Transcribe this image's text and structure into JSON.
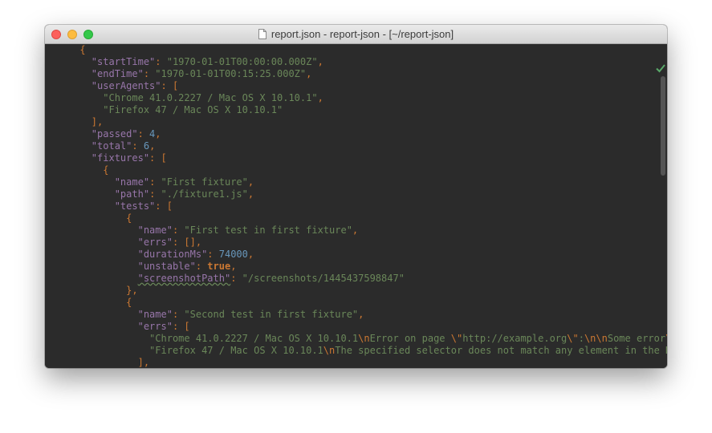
{
  "window": {
    "title": "report.json - report-json - [~/report-json]"
  },
  "editor": {
    "lines": [
      [
        {
          "c": "p",
          "t": "      {"
        }
      ],
      [
        {
          "c": "p",
          "t": "        "
        },
        {
          "c": "k",
          "t": "\"startTime\""
        },
        {
          "c": "p",
          "t": ": "
        },
        {
          "c": "s",
          "t": "\"1970-01-01T00:00:00.000Z\""
        },
        {
          "c": "p",
          "t": ","
        }
      ],
      [
        {
          "c": "p",
          "t": "        "
        },
        {
          "c": "k",
          "t": "\"endTime\""
        },
        {
          "c": "p",
          "t": ": "
        },
        {
          "c": "s",
          "t": "\"1970-01-01T00:15:25.000Z\""
        },
        {
          "c": "p",
          "t": ","
        }
      ],
      [
        {
          "c": "p",
          "t": "        "
        },
        {
          "c": "k",
          "t": "\"userAgents\""
        },
        {
          "c": "p",
          "t": ": ["
        }
      ],
      [
        {
          "c": "p",
          "t": "          "
        },
        {
          "c": "s",
          "t": "\"Chrome 41.0.2227 / Mac OS X 10.10.1\""
        },
        {
          "c": "p",
          "t": ","
        }
      ],
      [
        {
          "c": "p",
          "t": "          "
        },
        {
          "c": "s",
          "t": "\"Firefox 47 / Mac OS X 10.10.1\""
        }
      ],
      [
        {
          "c": "p",
          "t": "        ],"
        }
      ],
      [
        {
          "c": "p",
          "t": "        "
        },
        {
          "c": "k",
          "t": "\"passed\""
        },
        {
          "c": "p",
          "t": ": "
        },
        {
          "c": "n",
          "t": "4"
        },
        {
          "c": "p",
          "t": ","
        }
      ],
      [
        {
          "c": "p",
          "t": "        "
        },
        {
          "c": "k",
          "t": "\"total\""
        },
        {
          "c": "p",
          "t": ": "
        },
        {
          "c": "n",
          "t": "6"
        },
        {
          "c": "p",
          "t": ","
        }
      ],
      [
        {
          "c": "p",
          "t": "        "
        },
        {
          "c": "k",
          "t": "\"fixtures\""
        },
        {
          "c": "p",
          "t": ": ["
        }
      ],
      [
        {
          "c": "p",
          "t": "          {"
        }
      ],
      [
        {
          "c": "p",
          "t": "            "
        },
        {
          "c": "k",
          "t": "\"name\""
        },
        {
          "c": "p",
          "t": ": "
        },
        {
          "c": "s",
          "t": "\"First fixture\""
        },
        {
          "c": "p",
          "t": ","
        }
      ],
      [
        {
          "c": "p",
          "t": "            "
        },
        {
          "c": "k",
          "t": "\"path\""
        },
        {
          "c": "p",
          "t": ": "
        },
        {
          "c": "s",
          "t": "\"./fixture1.js\""
        },
        {
          "c": "p",
          "t": ","
        }
      ],
      [
        {
          "c": "p",
          "t": "            "
        },
        {
          "c": "k",
          "t": "\"tests\""
        },
        {
          "c": "p",
          "t": ": ["
        }
      ],
      [
        {
          "c": "p",
          "t": "              {"
        }
      ],
      [
        {
          "c": "p",
          "t": "                "
        },
        {
          "c": "k",
          "t": "\"name\""
        },
        {
          "c": "p",
          "t": ": "
        },
        {
          "c": "s",
          "t": "\"First test in first fixture\""
        },
        {
          "c": "p",
          "t": ","
        }
      ],
      [
        {
          "c": "p",
          "t": "                "
        },
        {
          "c": "k",
          "t": "\"errs\""
        },
        {
          "c": "p",
          "t": ": [],"
        }
      ],
      [
        {
          "c": "p",
          "t": "                "
        },
        {
          "c": "k",
          "t": "\"durationMs\""
        },
        {
          "c": "p",
          "t": ": "
        },
        {
          "c": "n",
          "t": "74000"
        },
        {
          "c": "p",
          "t": ","
        }
      ],
      [
        {
          "c": "p",
          "t": "                "
        },
        {
          "c": "k",
          "t": "\"unstable\""
        },
        {
          "c": "p",
          "t": ": "
        },
        {
          "c": "b",
          "t": "true"
        },
        {
          "c": "p",
          "t": ","
        }
      ],
      [
        {
          "c": "p",
          "t": "                "
        },
        {
          "c": "k",
          "t": "\"screenshotPath\""
        },
        {
          "c": "p",
          "t": ": "
        },
        {
          "c": "s",
          "t": "\"/screenshots/1445437598847\""
        }
      ],
      [
        {
          "c": "p",
          "t": "              },"
        }
      ],
      [
        {
          "c": "p",
          "t": "              {"
        }
      ],
      [
        {
          "c": "p",
          "t": "                "
        },
        {
          "c": "k",
          "t": "\"name\""
        },
        {
          "c": "p",
          "t": ": "
        },
        {
          "c": "s",
          "t": "\"Second test in first fixture\""
        },
        {
          "c": "p",
          "t": ","
        }
      ],
      [
        {
          "c": "p",
          "t": "                "
        },
        {
          "c": "k",
          "t": "\"errs\""
        },
        {
          "c": "p",
          "t": ": ["
        }
      ],
      [
        {
          "c": "p",
          "t": "                  "
        },
        {
          "c": "s",
          "t": "\"Chrome 41.0.2227 / Mac OS X 10.10.1"
        },
        {
          "c": "e",
          "t": "\\n"
        },
        {
          "c": "s",
          "t": "Error on page "
        },
        {
          "c": "e",
          "t": "\\\""
        },
        {
          "c": "s",
          "t": "http://example.org"
        },
        {
          "c": "e",
          "t": "\\\""
        },
        {
          "c": "s",
          "t": ":"
        },
        {
          "c": "e",
          "t": "\\n\\n"
        },
        {
          "c": "s",
          "t": "Some error"
        },
        {
          "c": "e",
          "t": "\\n\\n"
        }
      ],
      [
        {
          "c": "p",
          "t": "                  "
        },
        {
          "c": "s",
          "t": "\"Firefox 47 / Mac OS X 10.10.1"
        },
        {
          "c": "e",
          "t": "\\n"
        },
        {
          "c": "s",
          "t": "The specified selector does not match any element in the DOM t"
        }
      ],
      [
        {
          "c": "p",
          "t": "                ],"
        }
      ]
    ]
  }
}
